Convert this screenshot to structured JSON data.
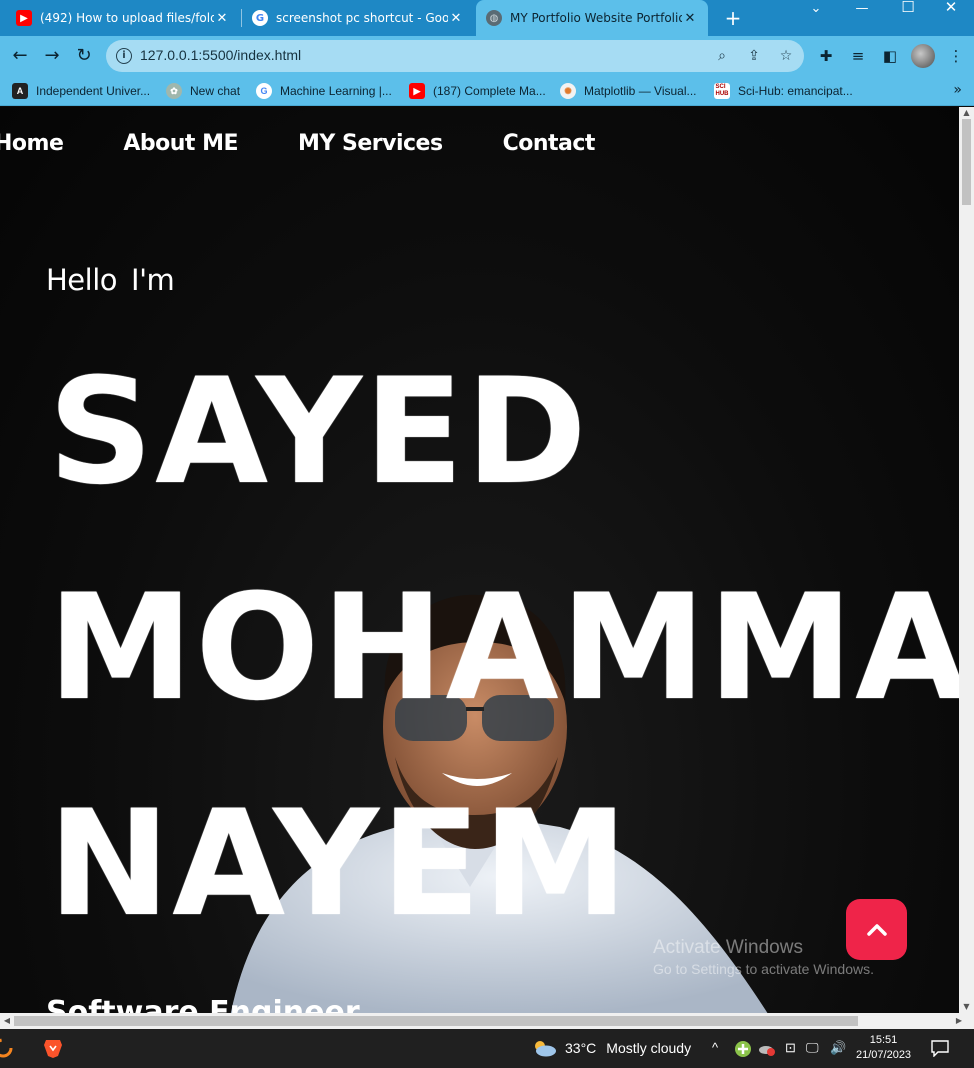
{
  "browser": {
    "tabs": [
      {
        "title": "(492) How to upload files/folder",
        "favicon": "youtube-icon",
        "active": false
      },
      {
        "title": "screenshot pc shortcut - Google",
        "favicon": "google-icon",
        "active": false
      },
      {
        "title": "MY Portfolio Website Portfolio",
        "favicon": "globe-icon",
        "active": true
      }
    ],
    "new_tab": "+",
    "url": "127.0.0.1:5500/index.html",
    "bookmarks": [
      {
        "label": "Independent Univer...",
        "icon": "angular-icon"
      },
      {
        "label": "New chat",
        "icon": "openai-icon"
      },
      {
        "label": "Machine Learning |...",
        "icon": "google-icon"
      },
      {
        "label": "(187) Complete Ma...",
        "icon": "youtube-icon"
      },
      {
        "label": "Matplotlib — Visual...",
        "icon": "matplotlib-icon"
      },
      {
        "label": "Sci-Hub: emancipat...",
        "icon": "scihub-icon"
      }
    ],
    "bookmarks_more": "»"
  },
  "page": {
    "nav": [
      "Home",
      "About ME",
      "MY Services",
      "Contact"
    ],
    "hello": "Hello",
    "im": "I'm",
    "name_lines": [
      "SAYED",
      "MOHAMMAD",
      "NAYEM"
    ],
    "subtitle": "Software Engineer",
    "watermark_title": "Activate Windows",
    "watermark_sub": "Go to Settings to activate Windows.",
    "accent": "#ef2449"
  },
  "taskbar": {
    "temperature": "33°C",
    "weather": "Mostly cloudy",
    "time": "15:51",
    "date": "21/07/2023"
  }
}
